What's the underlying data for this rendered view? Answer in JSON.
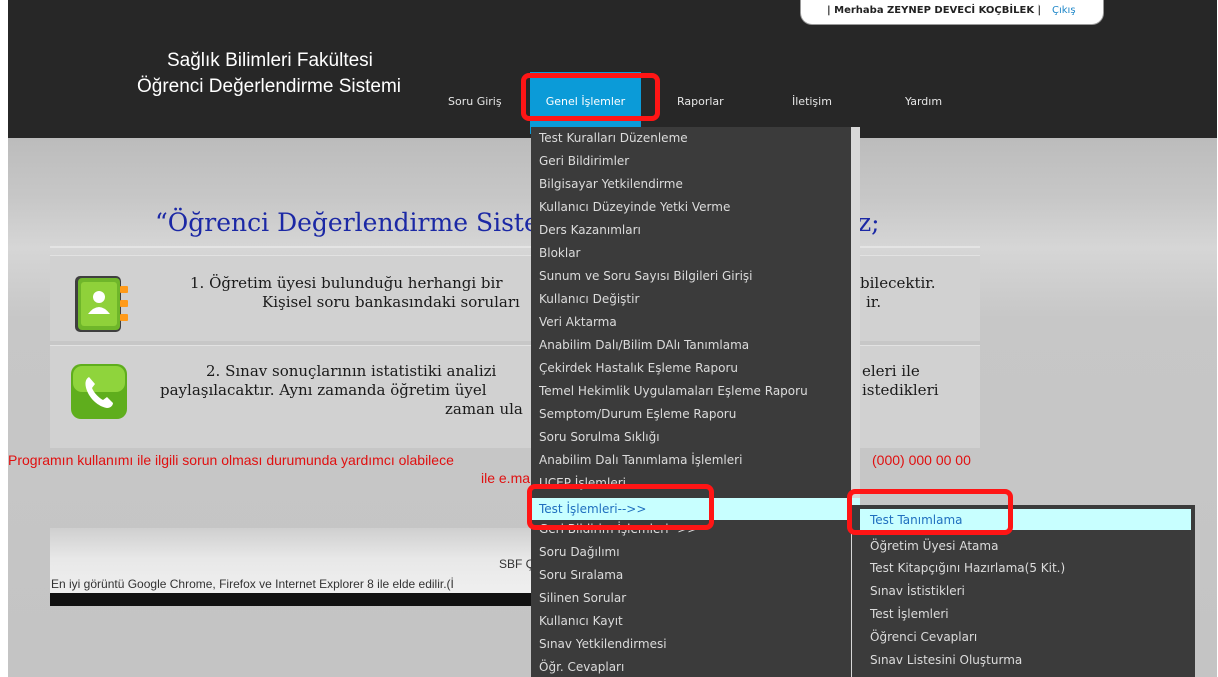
{
  "header": {
    "user_greeting": "| Merhaba ZEYNEP DEVECİ KOÇBİLEK |",
    "logout": "Çıkış",
    "brand_line1": "Sağlık Bilimleri Fakültesi",
    "brand_line2": "Öğrenci Değerlendirme Sistemi",
    "nav": {
      "soru_giris": "Soru Giriş",
      "genel_islemler": "Genel İşlemler",
      "raporlar": "Raporlar",
      "iletisim": "İletişim",
      "yardim": "Yardım"
    }
  },
  "main": {
    "welcome_title": "“Öğrenci Değerlendirme Siste",
    "welcome_title_end": "z;",
    "item1_line1_left": "1. Öğretim üyesi bulunduğu herhangi bir",
    "item1_line1_right": "bilecektir.",
    "item1_line2_left": "Kişisel soru bankasındaki soruları",
    "item1_line2_right": "ir.",
    "item2_line1_left": "2. Sınav sonuçlarının istatistiki analizi",
    "item2_line1_right": "eleri ile",
    "item2_line2_left": "paylaşılacaktır. Aynı zamanda öğretim üyel",
    "item2_line2_right": "istedikleri",
    "item2_line3_left": "zaman ula",
    "help_line1_left": "Programın kullanımı ile ilgili sorun olması durumunda yardımcı olabilece",
    "help_line1_right": "(000) 000 00 00",
    "help_line2_left": "ile e.ma",
    "icon_book": "contacts-book-icon",
    "icon_phone": "phone-icon",
    "colors": {
      "title": "#1b28a5",
      "help": "#e01010"
    }
  },
  "footer": {
    "line1": "SBF Ç",
    "line2": "En iyi görüntü Google Chrome, Firefox  ve  Internet Explorer 8 ile elde edilir.(İ"
  },
  "menu": {
    "items": [
      "Test Kuralları Düzenleme",
      "Geri Bildirimler",
      "Bilgisayar Yetkilendirme",
      "Kullanıcı Düzeyinde Yetki Verme",
      "Ders Kazanımları",
      "Bloklar",
      "Sunum ve Soru Sayısı Bilgileri Girişi",
      "Kullanıcı Değiştir",
      "Veri Aktarma",
      "Anabilim Dalı/Bilim DAlı Tanımlama",
      "Çekirdek Hastalık Eşleme Raporu",
      "Temel Hekimlik Uygulamaları Eşleme Raporu",
      "Semptom/Durum Eşleme Raporu",
      "Soru Sorulma Sıklığı",
      "Anabilim Dalı Tanımlama İşlemleri",
      "UCEP İşlemleri",
      "Test İşlemleri-->>",
      "Geri Bildirim İşlemleri-->>",
      "Soru Dağılımı",
      "Soru Sıralama",
      "Silinen Sorular",
      "Kullanıcı Kayıt",
      "Sınav Yetkilendirmesi",
      "Öğr. Cevapları"
    ]
  },
  "submenu": {
    "items": [
      "Test Tanımlama",
      "Öğretim Üyesi Atama",
      "Test Kitapçığını Hazırlama(5 Kit.)",
      "Sınav İstistikleri",
      "Test İşlemleri",
      "Öğrenci Cevapları",
      "Sınav Listesini Oluşturma"
    ]
  },
  "colors": {
    "header_bg": "#272727",
    "nav_active": "#0b9bd8",
    "menu_bg": "#3b3b3b",
    "highlight": "#c8ffff",
    "annotation": "#ff1515"
  }
}
